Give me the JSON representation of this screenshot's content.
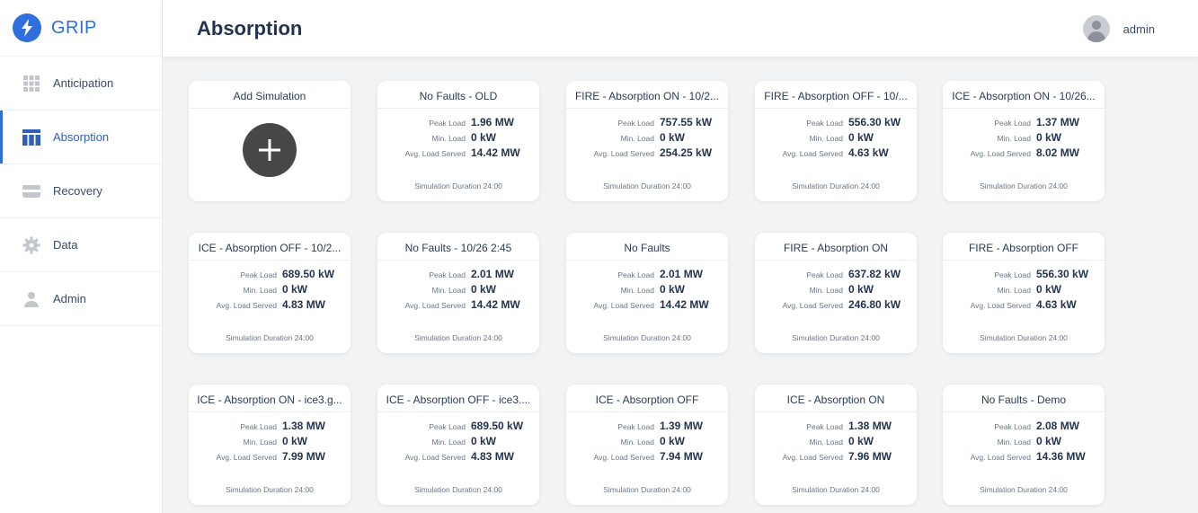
{
  "app": {
    "name": "GRIP"
  },
  "sidebar": {
    "items": [
      {
        "label": "Anticipation",
        "icon": "grid-icon"
      },
      {
        "label": "Absorption",
        "icon": "table-icon"
      },
      {
        "label": "Recovery",
        "icon": "drive-icon"
      },
      {
        "label": "Data",
        "icon": "gear-icon"
      },
      {
        "label": "Admin",
        "icon": "person-icon"
      }
    ],
    "active": "Absorption"
  },
  "header": {
    "title": "Absorption",
    "user": "admin"
  },
  "labels": {
    "add_simulation": "Add Simulation",
    "peak": "Peak Load",
    "min": "Min. Load",
    "avg": "Avg. Load Served"
  },
  "simulations": [
    {
      "title": "No Faults - OLD",
      "peak": "1.96 MW",
      "min": "0 kW",
      "avg": "14.42 MW",
      "duration": "Simulation Duration 24:00"
    },
    {
      "title": "FIRE - Absorption ON - 10/2...",
      "peak": "757.55 kW",
      "min": "0 kW",
      "avg": "254.25 kW",
      "duration": "Simulation Duration 24:00"
    },
    {
      "title": "FIRE - Absorption OFF - 10/...",
      "peak": "556.30 kW",
      "min": "0 kW",
      "avg": "4.63 kW",
      "duration": "Simulation Duration 24:00"
    },
    {
      "title": "ICE - Absorption ON - 10/26...",
      "peak": "1.37 MW",
      "min": "0 kW",
      "avg": "8.02 MW",
      "duration": "Simulation Duration 24:00"
    },
    {
      "title": "ICE - Absorption OFF - 10/2...",
      "peak": "689.50 kW",
      "min": "0 kW",
      "avg": "4.83 MW",
      "duration": "Simulation Duration 24:00"
    },
    {
      "title": "No Faults - 10/26 2:45",
      "peak": "2.01 MW",
      "min": "0 kW",
      "avg": "14.42 MW",
      "duration": "Simulation Duration 24:00"
    },
    {
      "title": "No Faults",
      "peak": "2.01 MW",
      "min": "0 kW",
      "avg": "14.42 MW",
      "duration": "Simulation Duration 24:00"
    },
    {
      "title": "FIRE - Absorption ON",
      "peak": "637.82 kW",
      "min": "0 kW",
      "avg": "246.80 kW",
      "duration": "Simulation Duration 24:00"
    },
    {
      "title": "FIRE - Absorption OFF",
      "peak": "556.30 kW",
      "min": "0 kW",
      "avg": "4.63 kW",
      "duration": "Simulation Duration 24:00"
    },
    {
      "title": "ICE - Absorption ON - ice3.g...",
      "peak": "1.38 MW",
      "min": "0 kW",
      "avg": "7.99 MW",
      "duration": "Simulation Duration 24:00"
    },
    {
      "title": "ICE - Absorption OFF - ice3....",
      "peak": "689.50 kW",
      "min": "0 kW",
      "avg": "4.83 MW",
      "duration": "Simulation Duration 24:00"
    },
    {
      "title": "ICE - Absorption OFF",
      "peak": "1.39 MW",
      "min": "0 kW",
      "avg": "7.94 MW",
      "duration": "Simulation Duration 24:00"
    },
    {
      "title": "ICE - Absorption ON",
      "peak": "1.38 MW",
      "min": "0 kW",
      "avg": "7.96 MW",
      "duration": "Simulation Duration 24:00"
    },
    {
      "title": "No Faults - Demo",
      "peak": "2.08 MW",
      "min": "0 kW",
      "avg": "14.36 MW",
      "duration": "Simulation Duration 24:00"
    }
  ],
  "colors": {
    "accent": "#2f6fdd",
    "add_button": "#474747"
  }
}
